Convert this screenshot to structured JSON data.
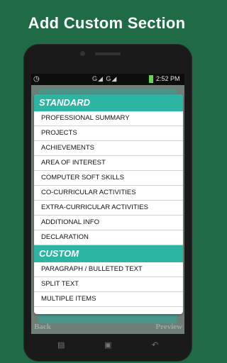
{
  "promo": {
    "title": "Add Custom Section"
  },
  "status_bar": {
    "time": "2:52 PM",
    "signal": "G◢ G◢"
  },
  "standard_section": {
    "header": "STANDARD",
    "items": [
      "PROFESSIONAL SUMMARY",
      "PROJECTS",
      "ACHIEVEMENTS",
      "AREA OF INTEREST",
      "COMPUTER SOFT SKILLS",
      "CO-CURRICULAR ACTIVITIES",
      "EXTRA-CURRICULAR ACTIVITIES",
      "ADDITIONAL INFO",
      "DECLARATION"
    ]
  },
  "custom_section": {
    "header": "CUSTOM",
    "items": [
      "PARAGRAPH / BULLETED TEXT",
      "SPLIT TEXT",
      "MULTIPLE ITEMS"
    ]
  },
  "bottom_bar": {
    "back_label": "Back",
    "preview_label": "Preview"
  },
  "colors": {
    "background": "#1e6b45",
    "header": "#2db5a3"
  }
}
